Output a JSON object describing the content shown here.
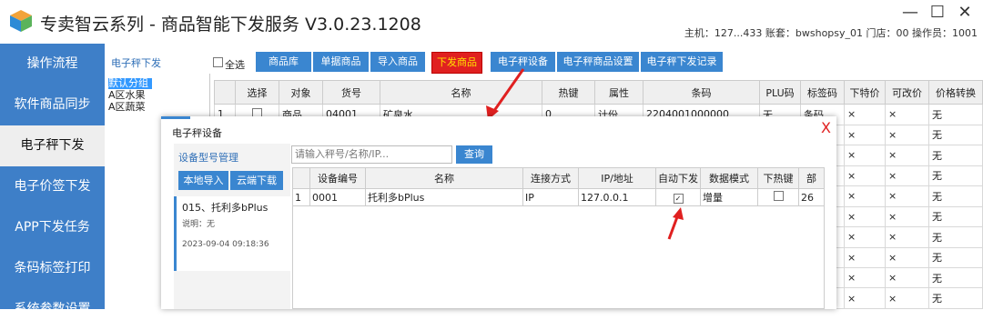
{
  "app": {
    "title": "专卖智云系列 - 商品智能下发服务 V3.0.23.1208",
    "user_info": "主机：127...433 账套：bwshopsy_01 门店：00 操作员：1001"
  },
  "window_controls": {
    "minimize": "—",
    "maximize": "☐",
    "close": "✕"
  },
  "sidebar": {
    "items": [
      {
        "label": "操作流程"
      },
      {
        "label": "软件商品同步"
      },
      {
        "label": "电子秤下发"
      },
      {
        "label": "电子价签下发"
      },
      {
        "label": "APP下发任务"
      },
      {
        "label": "条码标签打印"
      },
      {
        "label": "系统参数设置"
      }
    ]
  },
  "main": {
    "section_title": "电子秤下发",
    "tree": [
      "默认分组",
      "A区水果",
      "A区蔬菜"
    ],
    "select_all": "全选",
    "buttons": [
      "商品库",
      "单据商品",
      "导入商品",
      "下发商品",
      "电子秤设备",
      "电子秤商品设置",
      "电子秤下发记录"
    ],
    "columns": [
      "",
      "选择",
      "对象",
      "货号",
      "名称",
      "热键",
      "属性",
      "条码",
      "PLU码",
      "标签码",
      "下特价",
      "可改价",
      "价格转换"
    ],
    "row": {
      "num": "1",
      "obj": "商品",
      "code": "04001",
      "name": "矿泉水",
      "hotkey": "0",
      "attr": "计份",
      "barcode": "2204001000000",
      "plu": "无",
      "label": "条码",
      "special": "×",
      "changeable": "×",
      "convert": "无"
    },
    "filler_cells": {
      "special": "×",
      "changeable": "×",
      "convert": "无"
    }
  },
  "dialog": {
    "title": "电子秤设备",
    "close": "X",
    "left_title": "设备型号管理",
    "local_import": "本地导入",
    "cloud_download": "云端下载",
    "model": {
      "name": "015、托利多bPlus",
      "note": "说明：无",
      "time": "2023-09-04 09:18:36"
    },
    "search_placeholder": "请输入秤号/名称/IP...",
    "query": "查询",
    "columns": [
      "",
      "设备编号",
      "名称",
      "连接方式",
      "IP/地址",
      "自动下发",
      "数据模式",
      "下热键",
      "部"
    ],
    "rows": [
      {
        "num": "1",
        "id": "0001",
        "name": "托利多bPlus",
        "conn": "IP",
        "ip": "127.0.0.1",
        "auto": "✓",
        "mode": "增量",
        "hot": "",
        "dept": "26"
      }
    ]
  },
  "colors": {
    "accent": "#3a86d0",
    "sidebar": "#3e7fc8",
    "alert": "#e02020"
  }
}
